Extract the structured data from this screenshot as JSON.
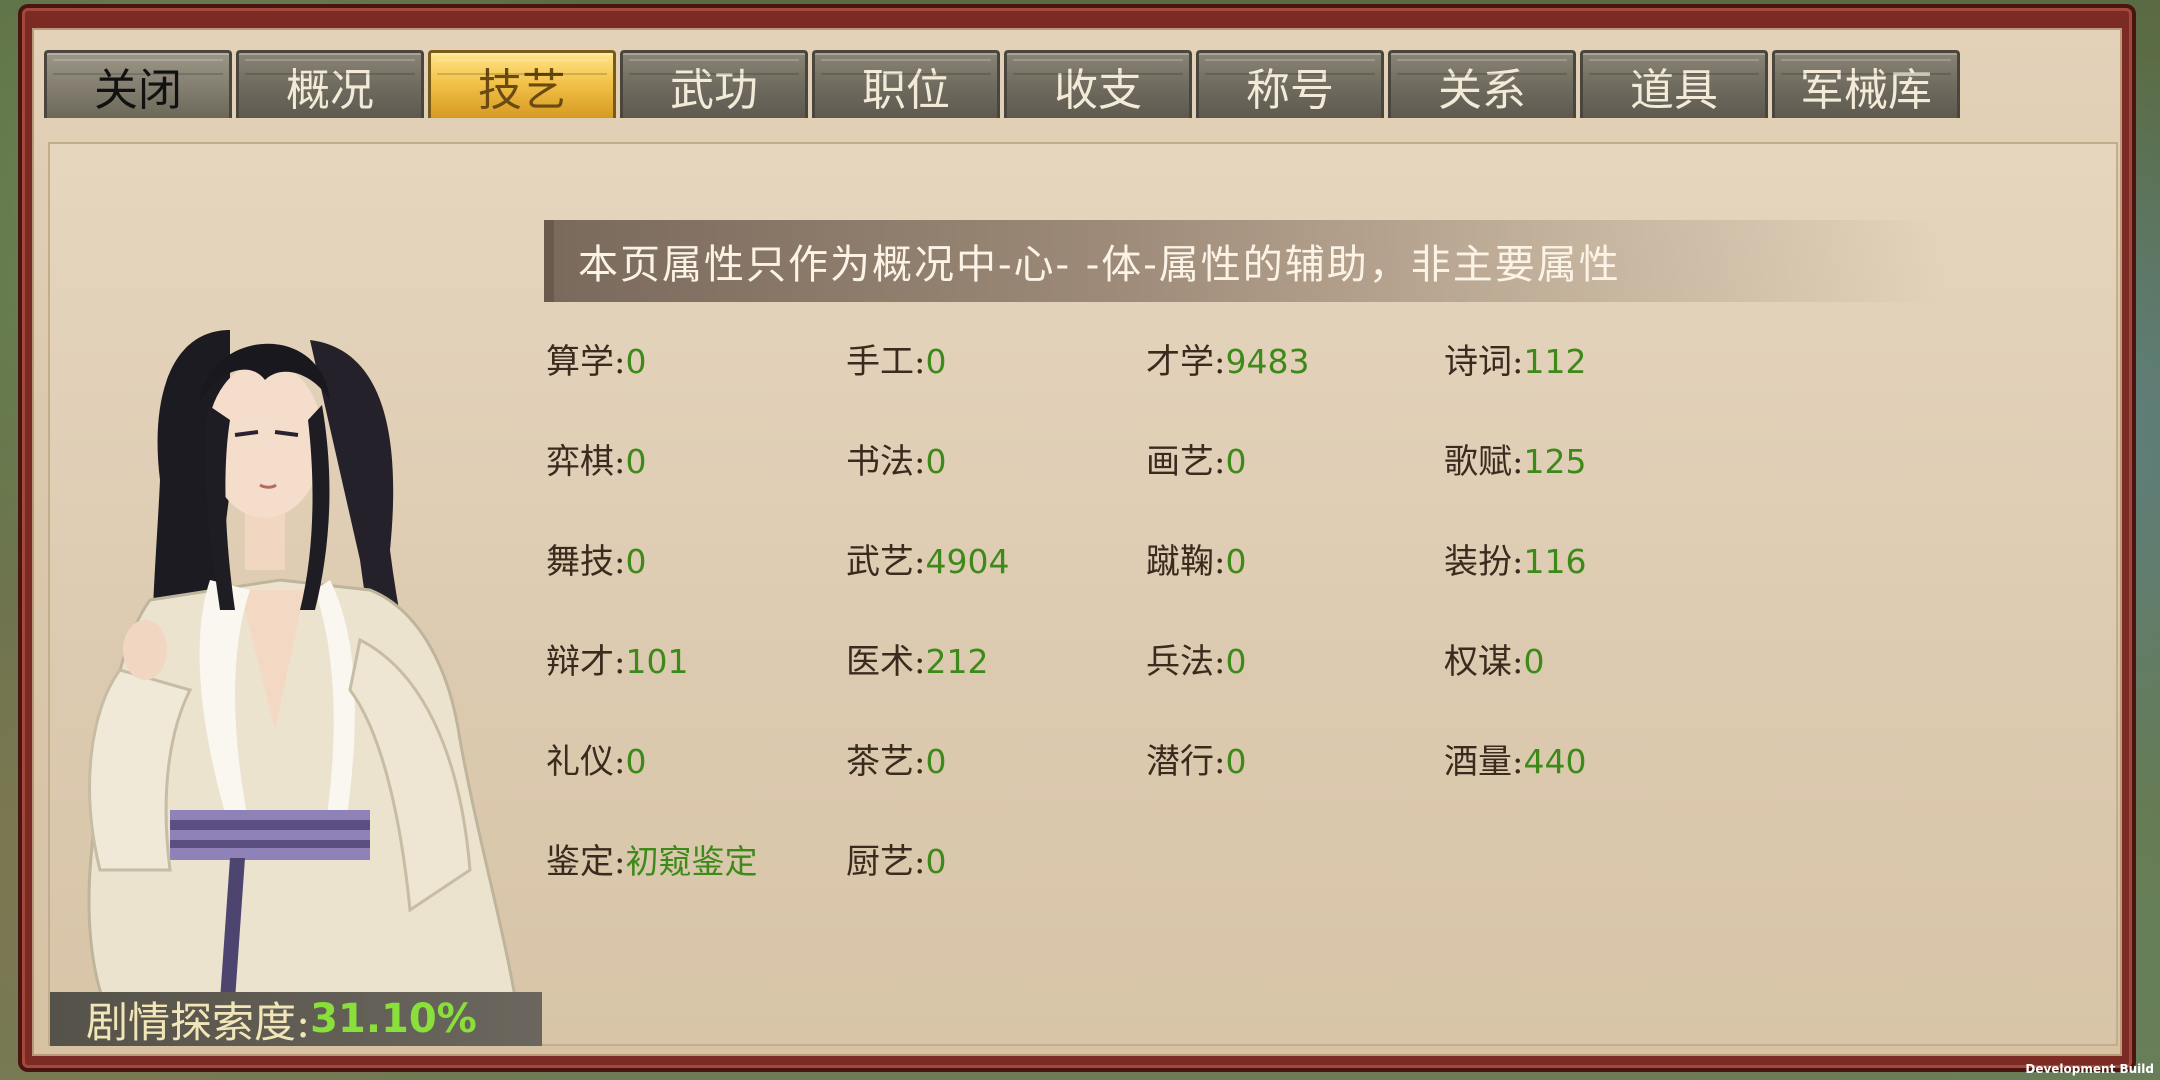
{
  "tabs": [
    {
      "label": "关闭",
      "state": "close"
    },
    {
      "label": "概况",
      "state": "normal"
    },
    {
      "label": "技艺",
      "state": "active"
    },
    {
      "label": "武功",
      "state": "normal"
    },
    {
      "label": "职位",
      "state": "normal"
    },
    {
      "label": "收支",
      "state": "normal"
    },
    {
      "label": "称号",
      "state": "normal"
    },
    {
      "label": "关系",
      "state": "normal"
    },
    {
      "label": "道具",
      "state": "normal"
    },
    {
      "label": "军械库",
      "state": "normal"
    }
  ],
  "notice": "本页属性只作为概况中-心- -体-属性的辅助，非主要属性",
  "attributes": [
    {
      "label": "算学:",
      "value": "0"
    },
    {
      "label": "手工:",
      "value": "0"
    },
    {
      "label": "才学:",
      "value": "9483"
    },
    {
      "label": "诗词:",
      "value": "112"
    },
    {
      "label": "弈棋:",
      "value": "0"
    },
    {
      "label": "书法:",
      "value": "0"
    },
    {
      "label": "画艺:",
      "value": "0"
    },
    {
      "label": "歌赋:",
      "value": "125"
    },
    {
      "label": "舞技:",
      "value": "0"
    },
    {
      "label": "武艺:",
      "value": "4904"
    },
    {
      "label": "蹴鞠:",
      "value": "0"
    },
    {
      "label": "装扮:",
      "value": "116"
    },
    {
      "label": "辩才:",
      "value": "101"
    },
    {
      "label": "医术:",
      "value": "212"
    },
    {
      "label": "兵法:",
      "value": "0"
    },
    {
      "label": "权谋:",
      "value": "0"
    },
    {
      "label": "礼仪:",
      "value": "0"
    },
    {
      "label": "茶艺:",
      "value": "0"
    },
    {
      "label": "潜行:",
      "value": "0"
    },
    {
      "label": "酒量:",
      "value": "440"
    },
    {
      "label": "鉴定:",
      "value": "初窥鉴定"
    },
    {
      "label": "厨艺:",
      "value": "0"
    }
  ],
  "story_progress": {
    "label": "剧情探索度:",
    "value": "31.10%"
  },
  "dev_build": "Development Build",
  "colors": {
    "value_green": "#3d8a1a",
    "active_tab": "#f3c24a",
    "frame": "#7c2b24"
  }
}
